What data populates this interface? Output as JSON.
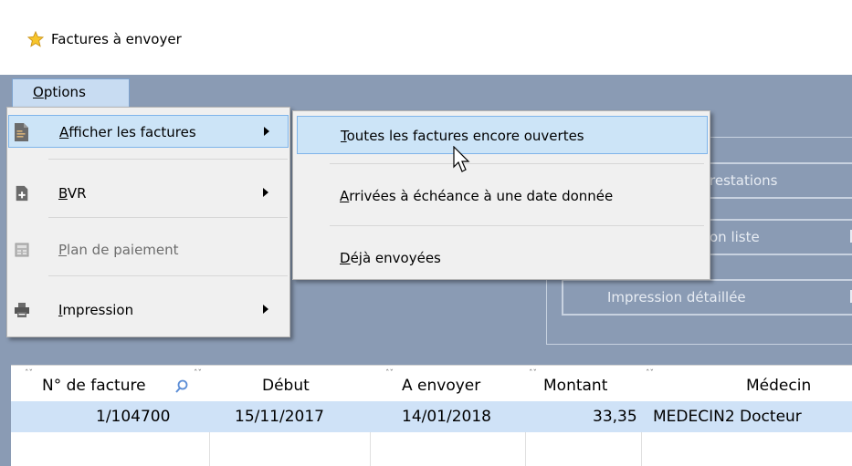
{
  "window": {
    "title": "Factures à envoyer",
    "icon": "star-icon"
  },
  "menubar": {
    "options_mnemonic": "O",
    "options_rest": "ptions"
  },
  "options_menu": {
    "items": [
      {
        "mnemonic": "A",
        "rest": "fficher les factures",
        "icon": "invoice-icon",
        "has_submenu": true,
        "enabled": true,
        "highlighted": true
      },
      {
        "mnemonic": "B",
        "rest": "VR",
        "icon": "add-document-icon",
        "has_submenu": true,
        "enabled": true,
        "highlighted": false
      },
      {
        "mnemonic": "P",
        "rest": "lan de paiement",
        "icon": "calculator-icon",
        "has_submenu": false,
        "enabled": false,
        "highlighted": false
      },
      {
        "mnemonic": "I",
        "rest": "mpression",
        "icon": "printer-icon",
        "has_submenu": true,
        "enabled": true,
        "highlighted": false
      }
    ]
  },
  "submenu": {
    "items": [
      {
        "mnemonic": "T",
        "rest": "outes les factures encore ouvertes",
        "highlighted": true
      },
      {
        "mnemonic": "A",
        "rest": "rrivées à échéance à une date donnée",
        "highlighted": false
      },
      {
        "mnemonic": "D",
        "rest": "éjà envoyées",
        "highlighted": false
      }
    ]
  },
  "background_buttons": [
    {
      "label": "restations"
    },
    {
      "label": "on liste"
    },
    {
      "label": "Impression détaillée"
    }
  ],
  "grid": {
    "columns": [
      "N° de facture",
      "Début",
      "A envoyer",
      "Montant",
      "Médecin"
    ],
    "rows": [
      [
        "1/104700",
        "15/11/2017",
        "14/01/2018",
        "33,35",
        "MEDECIN2 Docteur"
      ]
    ]
  },
  "colors": {
    "client_bg": "#8a9bb4",
    "menu_bg": "#f0f0f0",
    "highlight": "#cce4f7",
    "highlight_border": "#7eb4ea",
    "row_selected": "#cfe2f7"
  }
}
